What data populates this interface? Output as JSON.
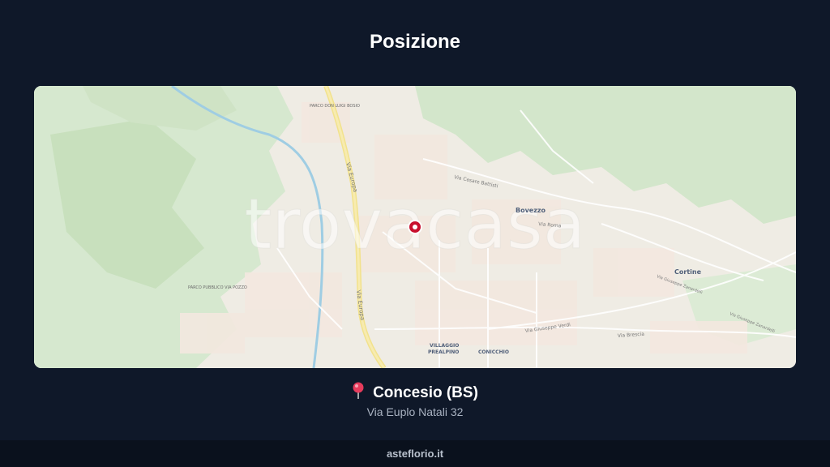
{
  "header": {
    "title": "Posizione"
  },
  "map": {
    "watermark": "trovacasa",
    "labels": {
      "parco_top": "PARCO DON LUIGI BOSIO",
      "via_europa_top": "Via Europa",
      "via_europa_bottom": "Via Europa",
      "via_cesare_battisti": "Via Cesare Battisti",
      "bovezzo": "Bovezzo",
      "via_roma": "Via Roma",
      "cortine": "Cortine",
      "via_giuseppe_zanardelli_1": "Via Giuseppe Zanardelli",
      "via_giuseppe_zanardelli_2": "Via Giuseppe Zanardelli",
      "parco_left": "PARCO PUBBLICO VIA POZZO",
      "via_giuseppe_verdi": "Via Giuseppe Verdi",
      "via_brescia": "Via Brescia",
      "villaggio": "VILLAGGIO",
      "prealpino": "PREALPINO",
      "conicchio": "CONICCHIO"
    },
    "colors": {
      "marker": "#c8102e",
      "park": "#cfe3c6",
      "road_main": "#f5ea9c"
    }
  },
  "location": {
    "pin_icon": "round-pushpin",
    "city": "Concesio (BS)",
    "address": "Via Euplo Natali 32"
  },
  "footer": {
    "site": "asteflorio.it"
  }
}
